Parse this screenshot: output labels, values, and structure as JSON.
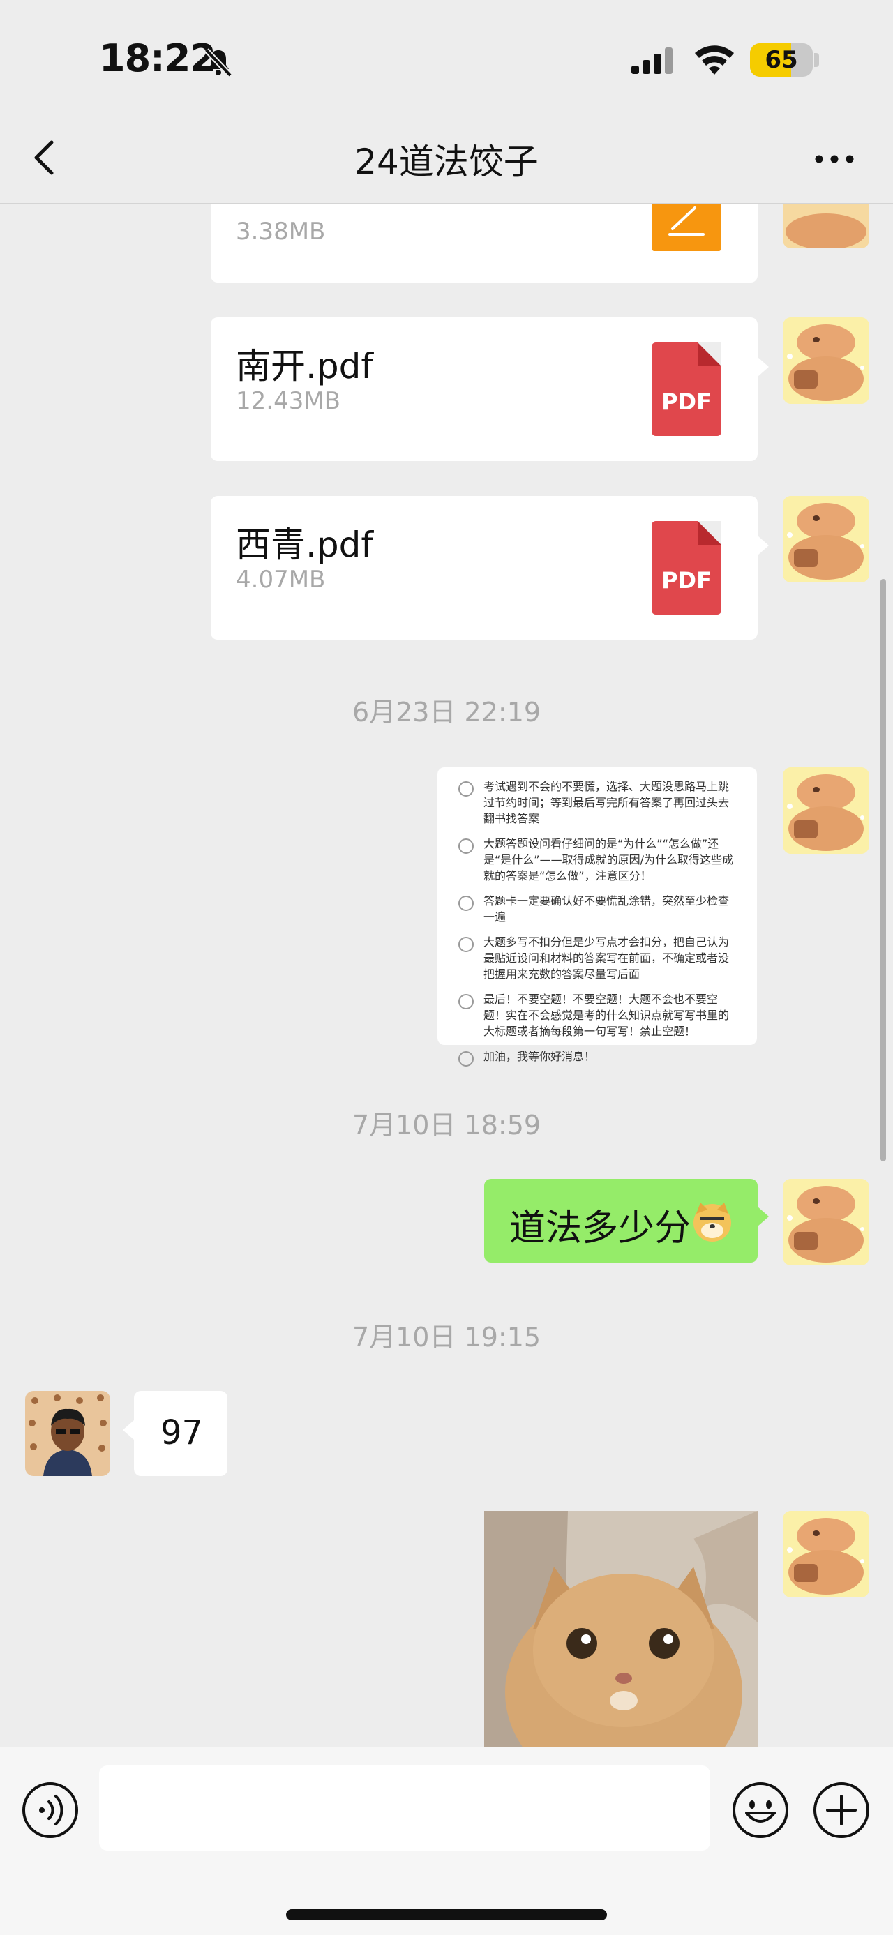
{
  "status_bar": {
    "time": "18:22",
    "battery": "65",
    "battery_level": 0.65
  },
  "navbar": {
    "title": "24道法饺子"
  },
  "messages": {
    "file_partial": {
      "size": "3.38MB"
    },
    "file1": {
      "name": "南开.pdf",
      "size": "12.43MB",
      "icon_label": "PDF"
    },
    "file2": {
      "name": "西青.pdf",
      "size": "4.07MB",
      "icon_label": "PDF"
    },
    "timestamp1": "6月23日 22:19",
    "note_items": [
      "考试遇到不会的不要慌，选择、大题没思路马上跳过节约时间；等到最后写完所有答案了再回过头去翻书找答案",
      "大题答题设问看仔细问的是“为什么”“怎么做”还是“是什么”——取得成就的原因/为什么取得这些成就的答案是“怎么做”，注意区分！",
      "答题卡一定要确认好不要慌乱涂错，突然至少检查一遍",
      "大题多写不扣分但是少写点才会扣分，把自己认为最贴近设问和材料的答案写在前面，不确定或者没把握用来充数的答案尽量写后面",
      "最后！不要空题！不要空题！大题不会也不要空题！实在不会感觉是考的什么知识点就写写书里的大标题或者摘每段第一句写写！禁止空题！",
      "加油，我等你好消息！"
    ],
    "timestamp2": "7月10日 18:59",
    "green_message": "道法多少分",
    "timestamp3": "7月10日 19:15",
    "reply": "97"
  },
  "input": {
    "placeholder": ""
  },
  "colors": {
    "green_bubble": "#95ec69",
    "background": "#ededed",
    "pdf_red": "#e0474c",
    "orange_file": "#f7960f"
  }
}
